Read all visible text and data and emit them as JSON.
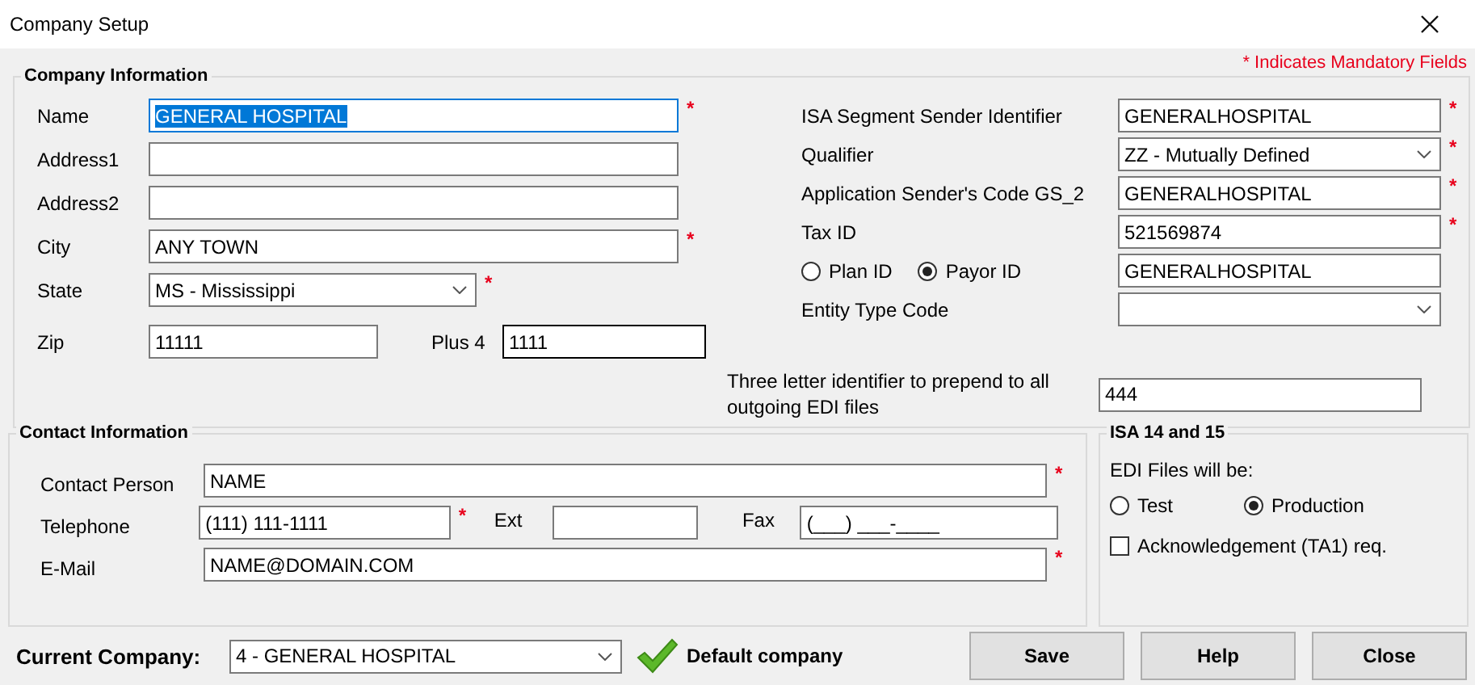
{
  "window": {
    "title": "Company Setup"
  },
  "required_mark": "*",
  "mandatory_note": "* Indicates Mandatory Fields",
  "company_info": {
    "title": "Company Information",
    "left_rows": [
      {
        "fields": [
          {
            "label": "Name",
            "kind": "text",
            "value": "GENERAL HOSPITAL",
            "required": true,
            "highlighted": true,
            "focused": false
          }
        ]
      },
      {
        "fields": [
          {
            "label": "Address1",
            "kind": "text",
            "required": false,
            "highlighted": false,
            "focused": false
          }
        ]
      },
      {
        "fields": [
          {
            "label": "Address2",
            "kind": "text",
            "required": false,
            "highlighted": false,
            "focused": false
          }
        ]
      },
      {
        "fields": [
          {
            "label": "City",
            "kind": "text",
            "value": "ANY TOWN",
            "required": true,
            "highlighted": false,
            "focused": false
          }
        ]
      },
      {
        "fields": [
          {
            "label": "State",
            "kind": "dropdown",
            "value": "MS - Mississippi",
            "required": true,
            "highlighted": false,
            "focused": false
          }
        ]
      },
      {
        "fields": [
          {
            "label": "Zip",
            "kind": "text",
            "value": "11111",
            "required": false,
            "highlighted": false,
            "focused": false
          },
          {
            "label": "Plus 4",
            "kind": "text",
            "value": "1111",
            "required": false,
            "highlighted": false,
            "focused": true
          }
        ]
      }
    ],
    "right_rows": [
      {
        "label": "ISA Segment Sender Identifier",
        "kind": "text",
        "value": "GENERALHOSPITAL",
        "required": true
      },
      {
        "label": "Qualifier",
        "kind": "dropdown",
        "value": "ZZ - Mutually Defined",
        "required": true
      },
      {
        "label": "Application Sender's Code GS_2",
        "kind": "text",
        "value": "GENERALHOSPITAL",
        "required": true
      },
      {
        "label": "Tax ID",
        "kind": "text",
        "value": "521569874",
        "required": true
      },
      {
        "kind": "radio_choice",
        "options": [
          {
            "label": "Plan ID",
            "selected": false
          },
          {
            "label": "Payor ID",
            "selected": true
          }
        ],
        "value": "GENERALHOSPITAL",
        "required": false
      },
      {
        "label": "Entity Type Code",
        "kind": "dropdown",
        "required": false
      }
    ],
    "prefix": {
      "label": "Three letter identifier to prepend to all outgoing EDI files",
      "value": "444"
    }
  },
  "contact_info": {
    "title": "Contact Information",
    "rows": [
      {
        "fields": [
          {
            "label": "Contact Person",
            "value": "NAME",
            "required": true
          }
        ]
      },
      {
        "fields": [
          {
            "label": "Telephone",
            "value": "(111) 111-1111",
            "required": true
          },
          {
            "label": "Ext",
            "required": false
          },
          {
            "label": "Fax",
            "value": "(___) ___-____",
            "required": false
          }
        ]
      },
      {
        "fields": [
          {
            "label": "E-Mail",
            "value": "NAME@DOMAIN.COM",
            "required": true
          }
        ]
      }
    ]
  },
  "isa": {
    "title": "ISA 14 and 15",
    "prompt": "EDI Files will be:",
    "options": [
      {
        "label": "Test",
        "selected": false
      },
      {
        "label": "Production",
        "selected": true
      }
    ],
    "acknowledgement": {
      "label": "Acknowledgement (TA1) req.",
      "checked": false
    }
  },
  "footer": {
    "label": "Current Company:",
    "value": "4 - GENERAL HOSPITAL",
    "default_note": "Default company",
    "buttons": [
      "Save",
      "Help",
      "Close"
    ]
  }
}
